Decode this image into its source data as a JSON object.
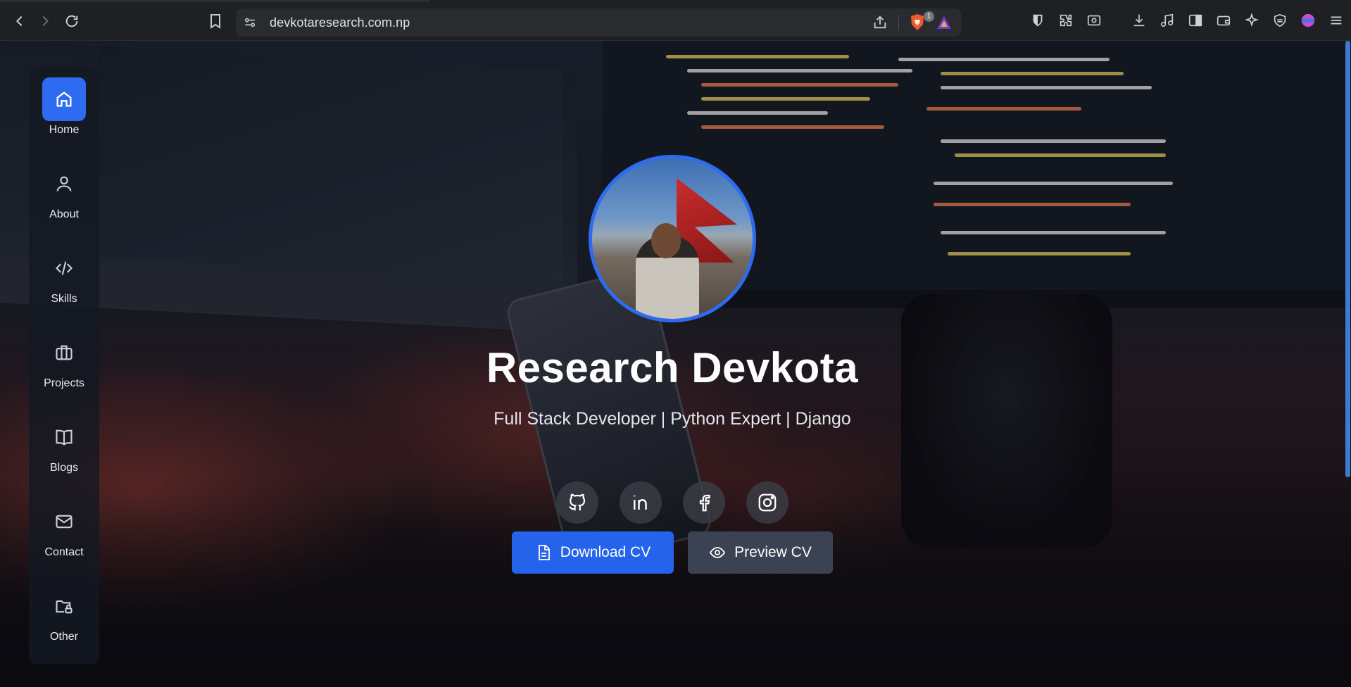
{
  "browser": {
    "url": "devkotaresearch.com.np",
    "shield_count": "1"
  },
  "sidebar": {
    "items": [
      {
        "label": "Home",
        "icon": "home-icon",
        "active": true
      },
      {
        "label": "About",
        "icon": "user-icon",
        "active": false
      },
      {
        "label": "Skills",
        "icon": "code-icon",
        "active": false
      },
      {
        "label": "Projects",
        "icon": "briefcase-icon",
        "active": false
      },
      {
        "label": "Blogs",
        "icon": "book-icon",
        "active": false
      },
      {
        "label": "Contact",
        "icon": "mail-icon",
        "active": false
      },
      {
        "label": "Other",
        "icon": "folder-lock-icon",
        "active": false
      }
    ]
  },
  "hero": {
    "name": "Research Devkota",
    "subtitle": "Full Stack Developer | Python Expert | Django",
    "socials": [
      "github-icon",
      "linkedin-icon",
      "facebook-icon",
      "instagram-icon"
    ],
    "download_label": "Download CV",
    "preview_label": "Preview CV"
  },
  "colors": {
    "accent": "#2563eb",
    "secondary_button": "#3b4352",
    "browser_chrome": "#1f2023"
  }
}
